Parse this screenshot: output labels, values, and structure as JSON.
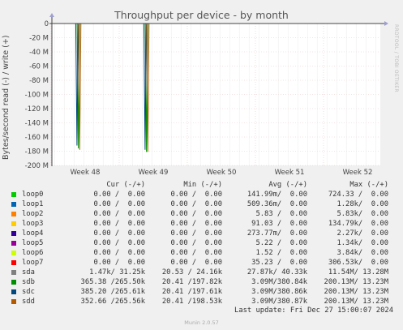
{
  "title": "Throughput per device - by month",
  "side_label": "RRDTOOL / TOBI OETIKER",
  "footer": {
    "last_update": "Last update: Fri Dec 27 15:00:07 2024",
    "munin_version": "Munin 2.0.57"
  },
  "legend": {
    "headers": [
      "Cur (-/+)",
      "Min (-/+)",
      "Avg (-/+)",
      "Max (-/+)"
    ],
    "rows": [
      {
        "name": "loop0",
        "color": "#00CC00",
        "cur": "0.00 /  0.00",
        "min": "0.00 /  0.00",
        "avg": "141.99m/  0.00",
        "max": "724.33 /  0.00"
      },
      {
        "name": "loop1",
        "color": "#0066B3",
        "cur": "0.00 /  0.00",
        "min": "0.00 /  0.00",
        "avg": "509.36m/  0.00",
        "max": "1.28k/  0.00"
      },
      {
        "name": "loop2",
        "color": "#FF8000",
        "cur": "0.00 /  0.00",
        "min": "0.00 /  0.00",
        "avg": "5.83 /  0.00",
        "max": "5.83k/  0.00"
      },
      {
        "name": "loop3",
        "color": "#FFCC00",
        "cur": "0.00 /  0.00",
        "min": "0.00 /  0.00",
        "avg": "91.03 /  0.00",
        "max": "134.79k/  0.00"
      },
      {
        "name": "loop4",
        "color": "#330099",
        "cur": "0.00 /  0.00",
        "min": "0.00 /  0.00",
        "avg": "273.77m/  0.00",
        "max": "2.27k/  0.00"
      },
      {
        "name": "loop5",
        "color": "#990099",
        "cur": "0.00 /  0.00",
        "min": "0.00 /  0.00",
        "avg": "5.22 /  0.00",
        "max": "1.34k/  0.00"
      },
      {
        "name": "loop6",
        "color": "#CCFF00",
        "cur": "0.00 /  0.00",
        "min": "0.00 /  0.00",
        "avg": "1.52 /  0.00",
        "max": "3.84k/  0.00"
      },
      {
        "name": "loop7",
        "color": "#FF0000",
        "cur": "0.00 /  0.00",
        "min": "0.00 /  0.00",
        "avg": "35.23 /  0.00",
        "max": "306.53k/  0.00"
      },
      {
        "name": "sda",
        "color": "#808080",
        "cur": "1.47k/ 31.25k",
        "min": "20.53 / 24.16k",
        "avg": "27.87k/ 40.33k",
        "max": "11.54M/ 13.28M"
      },
      {
        "name": "sdb",
        "color": "#008F00",
        "cur": "365.38 /265.50k",
        "min": "20.41 /197.82k",
        "avg": "3.09M/380.84k",
        "max": "200.13M/ 13.23M"
      },
      {
        "name": "sdc",
        "color": "#00487D",
        "cur": "385.20 /265.61k",
        "min": "20.41 /197.61k",
        "avg": "3.09M/380.86k",
        "max": "200.13M/ 13.23M"
      },
      {
        "name": "sdd",
        "color": "#B35A00",
        "cur": "352.66 /265.56k",
        "min": "20.41 /198.53k",
        "avg": "3.09M/380.87k",
        "max": "200.13M/ 13.23M"
      }
    ]
  },
  "chart_data": {
    "type": "line",
    "title": "Throughput per device - by month",
    "ylabel": "Bytes/second read (-) / write (+)",
    "ylim": [
      -200,
      0
    ],
    "y_unit": "M",
    "y_ticks": [
      0,
      -20,
      -40,
      -60,
      -80,
      -100,
      -120,
      -140,
      -160,
      -180,
      -200
    ],
    "y_tick_labels": [
      "0",
      "-20 M",
      "-40 M",
      "-60 M",
      "-80 M",
      "-100 M",
      "-120 M",
      "-140 M",
      "-160 M",
      "-180 M",
      "-200 M"
    ],
    "x_tick_labels": [
      "Week 48",
      "Week 49",
      "Week 50",
      "Week 51",
      "Week 52"
    ],
    "grid": true,
    "series": [
      {
        "name": "sdb",
        "color": "#008F00",
        "spikes": [
          {
            "week": 47.9,
            "value": -176
          },
          {
            "week": 48.9,
            "value": -181
          }
        ]
      },
      {
        "name": "sdc",
        "color": "#00487D",
        "spikes": [
          {
            "week": 47.88,
            "value": -172
          },
          {
            "week": 48.88,
            "value": -178
          }
        ]
      },
      {
        "name": "sdd",
        "color": "#B35A00",
        "spikes": [
          {
            "week": 47.92,
            "value": -178
          },
          {
            "week": 48.92,
            "value": -181
          }
        ]
      },
      {
        "name": "sda",
        "color": "#808080",
        "spikes": [
          {
            "week": 47.9,
            "value": -1
          },
          {
            "week": 48.9,
            "value": -1
          }
        ]
      }
    ]
  }
}
